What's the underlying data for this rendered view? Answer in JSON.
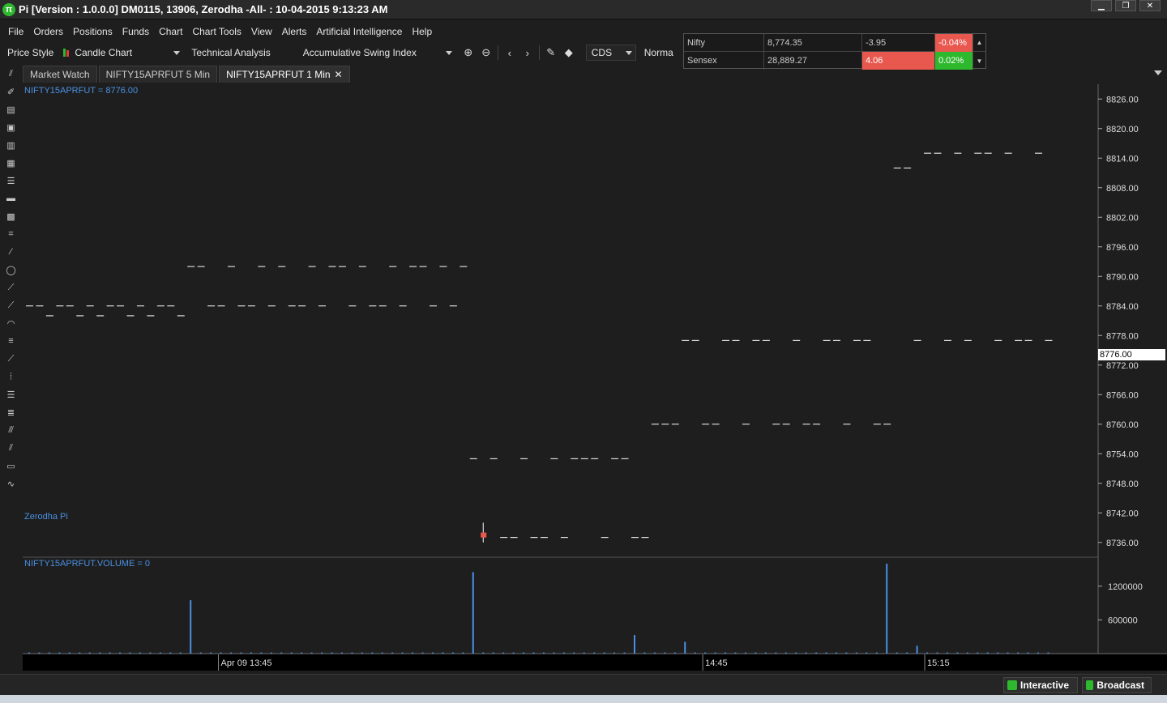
{
  "window": {
    "logo": "π",
    "title": "Pi [Version : 1.0.0.0] DM0115, 13906, Zerodha -All- : 10-04-2015 9:13:23 AM",
    "controls": [
      "▁",
      "❐",
      "✕"
    ]
  },
  "menu": [
    "File",
    "Orders",
    "Positions",
    "Funds",
    "Chart",
    "Chart Tools",
    "View",
    "Alerts",
    "Artificial Intelligence",
    "Help"
  ],
  "toolbar": {
    "price_style_label": "Price Style",
    "chart_type": "Candle Chart",
    "technical_analysis_label": "Technical Analysis",
    "indicator": "Accumulative Swing Index",
    "exchange": "CDS",
    "scale_mode": "Norma"
  },
  "indices": [
    {
      "name": "Nifty",
      "value": "8,774.35",
      "change": "-3.95",
      "pct": "-0.04%",
      "change_color": "",
      "pct_color": "#e8584f"
    },
    {
      "name": "Sensex",
      "value": "28,889.27",
      "change": "4.06",
      "pct": "0.02%",
      "change_color": "#e8584f",
      "pct_color": "#2eb82e"
    }
  ],
  "tabs": [
    {
      "label": "Market Watch",
      "active": false
    },
    {
      "label": "NIFTY15APRFUT 5 Min",
      "active": false
    },
    {
      "label": "NIFTY15APRFUT 1 Min",
      "active": true,
      "close": "✕"
    }
  ],
  "chart": {
    "price_label": "NIFTY15APRFUT = 8776.00",
    "watermark": "Zerodha Pi",
    "volume_label": "NIFTY15APRFUT.VOLUME = 0",
    "current_price": "8776.00",
    "price_ticks": [
      "8826.00",
      "8820.00",
      "8814.00",
      "8808.00",
      "8802.00",
      "8796.00",
      "8790.00",
      "8784.00",
      "8778.00",
      "8772.00",
      "8766.00",
      "8760.00",
      "8754.00",
      "8748.00",
      "8742.00",
      "8736.00"
    ],
    "volume_ticks": [
      "1200000",
      "600000"
    ],
    "time_labels": [
      "Apr 09 13:45",
      "14:45",
      "15:15"
    ]
  },
  "chart_data": {
    "type": "bar",
    "price_axis": {
      "min": 8733,
      "max": 8829,
      "tick_values": [
        8826,
        8820,
        8814,
        8808,
        8802,
        8796,
        8790,
        8784,
        8778,
        8772,
        8766,
        8760,
        8754,
        8748,
        8742,
        8736
      ]
    },
    "volume_axis": {
      "min": 0,
      "max": 1600000,
      "tick_values": [
        1200000,
        600000
      ]
    },
    "price_series": [
      [
        0,
        8784
      ],
      [
        1,
        8784
      ],
      [
        2,
        8782
      ],
      [
        3,
        8784
      ],
      [
        4,
        8784
      ],
      [
        5,
        8782
      ],
      [
        6,
        8784
      ],
      [
        7,
        8782
      ],
      [
        8,
        8784
      ],
      [
        9,
        8784
      ],
      [
        10,
        8782
      ],
      [
        11,
        8784
      ],
      [
        12,
        8782
      ],
      [
        13,
        8784
      ],
      [
        14,
        8784
      ],
      [
        15,
        8782
      ],
      [
        16,
        8792
      ],
      [
        17,
        8792
      ],
      [
        18,
        8784
      ],
      [
        19,
        8784
      ],
      [
        20,
        8792
      ],
      [
        21,
        8784
      ],
      [
        22,
        8784
      ],
      [
        23,
        8792
      ],
      [
        24,
        8784
      ],
      [
        25,
        8792
      ],
      [
        26,
        8784
      ],
      [
        27,
        8784
      ],
      [
        28,
        8792
      ],
      [
        29,
        8784
      ],
      [
        30,
        8792
      ],
      [
        31,
        8792
      ],
      [
        32,
        8784
      ],
      [
        33,
        8792
      ],
      [
        34,
        8784
      ],
      [
        35,
        8784
      ],
      [
        36,
        8792
      ],
      [
        37,
        8784
      ],
      [
        38,
        8792
      ],
      [
        39,
        8792
      ],
      [
        40,
        8784
      ],
      [
        41,
        8792
      ],
      [
        42,
        8784
      ],
      [
        43,
        8792
      ],
      [
        44,
        8753
      ],
      [
        45,
        8738
      ],
      [
        46,
        8753
      ],
      [
        47,
        8737
      ],
      [
        48,
        8737
      ],
      [
        49,
        8753
      ],
      [
        50,
        8737
      ],
      [
        51,
        8737
      ],
      [
        52,
        8753
      ],
      [
        53,
        8737
      ],
      [
        54,
        8753
      ],
      [
        55,
        8753
      ],
      [
        56,
        8753
      ],
      [
        57,
        8737
      ],
      [
        58,
        8753
      ],
      [
        59,
        8753
      ],
      [
        60,
        8737
      ],
      [
        61,
        8737
      ],
      [
        62,
        8760
      ],
      [
        63,
        8760
      ],
      [
        64,
        8760
      ],
      [
        65,
        8777
      ],
      [
        66,
        8777
      ],
      [
        67,
        8760
      ],
      [
        68,
        8760
      ],
      [
        69,
        8777
      ],
      [
        70,
        8777
      ],
      [
        71,
        8760
      ],
      [
        72,
        8777
      ],
      [
        73,
        8777
      ],
      [
        74,
        8760
      ],
      [
        75,
        8760
      ],
      [
        76,
        8777
      ],
      [
        77,
        8760
      ],
      [
        78,
        8760
      ],
      [
        79,
        8777
      ],
      [
        80,
        8777
      ],
      [
        81,
        8760
      ],
      [
        82,
        8777
      ],
      [
        83,
        8777
      ],
      [
        84,
        8760
      ],
      [
        85,
        8760
      ],
      [
        86,
        8812
      ],
      [
        87,
        8812
      ],
      [
        88,
        8777
      ],
      [
        89,
        8815
      ],
      [
        90,
        8815
      ],
      [
        91,
        8777
      ],
      [
        92,
        8815
      ],
      [
        93,
        8777
      ],
      [
        94,
        8815
      ],
      [
        95,
        8815
      ],
      [
        96,
        8777
      ],
      [
        97,
        8815
      ],
      [
        98,
        8777
      ],
      [
        99,
        8777
      ],
      [
        100,
        8815
      ],
      [
        101,
        8777
      ]
    ],
    "signal_candle": {
      "index": 45,
      "open": 8738,
      "close": 8737,
      "high": 8740,
      "low": 8736,
      "color": "#e8584f"
    },
    "volume_spikes": [
      {
        "index": 16,
        "value": 950000
      },
      {
        "index": 44,
        "value": 1450000
      },
      {
        "index": 60,
        "value": 330000
      },
      {
        "index": 65,
        "value": 210000
      },
      {
        "index": 85,
        "value": 1600000
      },
      {
        "index": 88,
        "value": 140000
      }
    ],
    "volume_baseline": 20000,
    "bars": 102,
    "grid": true,
    "colors": {
      "background": "#1e1e1e",
      "price_tick": "#ffffff",
      "volume": "#4a90e2",
      "axis_text": "#dddddd"
    }
  },
  "status": {
    "interactive": "Interactive",
    "broadcast": "Broadcast"
  }
}
